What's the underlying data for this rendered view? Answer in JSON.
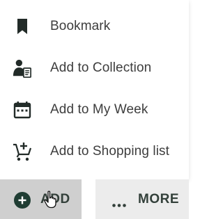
{
  "menu": {
    "items": [
      {
        "label": "Bookmark",
        "icon": "bookmark-icon"
      },
      {
        "label": "Add to Collection",
        "icon": "collection-user-icon"
      },
      {
        "label": "Add to My Week",
        "icon": "calendar-icon"
      },
      {
        "label": "Add to Shopping list",
        "icon": "cart-plus-icon"
      }
    ]
  },
  "toolbar": {
    "add_label": "ADD",
    "more_label": "MORE",
    "add_icon": "add-circle-icon",
    "more_icon": "more-horizontal-icon"
  },
  "colors": {
    "icon": "#222b28",
    "text": "#3d3d3d",
    "add_button_bg": "#cfcfcf",
    "more_button_bg": "#ececec",
    "accent_dark_green": "#1f3d33"
  }
}
